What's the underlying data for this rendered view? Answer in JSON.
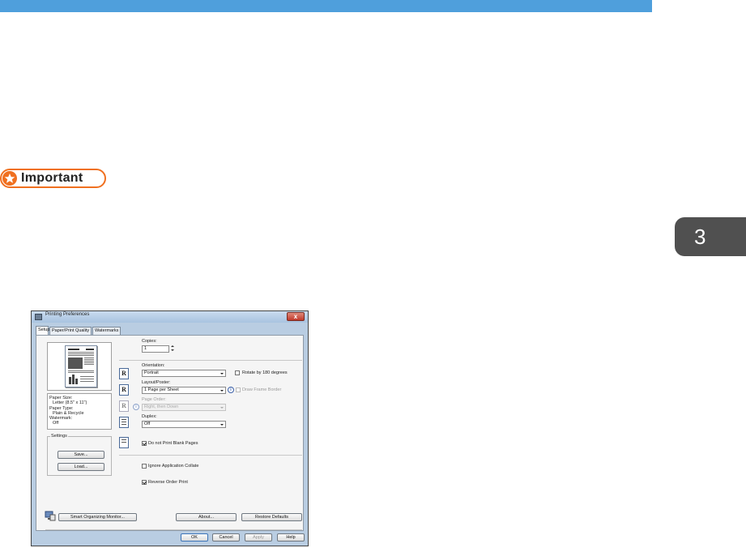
{
  "chapter": {
    "number": "3"
  },
  "important": {
    "label": "Important"
  },
  "dialog": {
    "title": "Printing Preferences",
    "close_glyph": "x",
    "tabs": [
      "Setup",
      "Paper/Print Quality",
      "Watermarks"
    ],
    "summary": {
      "paper_size_label": "Paper Size:",
      "paper_size_value": "Letter (8.5\" x 11\")",
      "paper_type_label": "Paper Type:",
      "paper_type_value": "Plain & Recycle",
      "watermark_label": "Watermark:",
      "watermark_value": "Off"
    },
    "settings": {
      "legend": "Settings",
      "save_label": "Save...",
      "load_label": "Load..."
    },
    "copies": {
      "label": "Copies:",
      "value": "1"
    },
    "orientation": {
      "label": "Orientation:",
      "value": "Portrait"
    },
    "rotate": {
      "label": "Rotate by 180 degrees",
      "checked": false
    },
    "layout": {
      "label": "Layout/Poster:",
      "value": "1 Page per Sheet"
    },
    "frame_border": {
      "label": "Draw Frame Border",
      "checked": false
    },
    "page_order": {
      "label": "Page Order:",
      "value": "Right, then Down"
    },
    "duplex": {
      "label": "Duplex:",
      "value": "Off"
    },
    "blank_pages": {
      "label": "Do not Print Blank Pages",
      "checked": true
    },
    "ignore_collate": {
      "label": "Ignore Application Collate",
      "checked": false
    },
    "reverse_order": {
      "label": "Reverse Order Print",
      "checked": true
    },
    "buttons": {
      "smart_monitor": "Smart Organizing Monitor...",
      "about": "About...",
      "restore_defaults": "Restore Defaults",
      "ok": "OK",
      "cancel": "Cancel",
      "apply": "Apply",
      "help": "Help"
    },
    "icons": {
      "r_glyph": "R",
      "info_glyph": "i"
    }
  },
  "colors": {
    "topbar": "#4f9fdc",
    "chapter_tab": "#505050",
    "important_accent": "#f07020"
  }
}
